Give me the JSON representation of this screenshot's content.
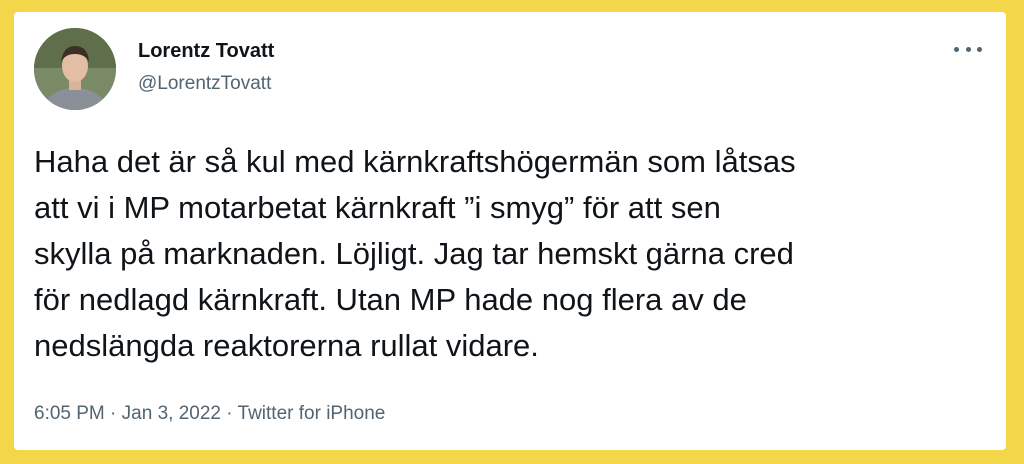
{
  "tweet": {
    "author_name": "Lorentz Tovatt",
    "author_handle": "@LorentzTovatt",
    "more_icon": "more-horizontal-icon",
    "text_lines": [
      "Haha det är så kul med kärnkraftshögermän som låtsas",
      "att vi i MP motarbetat kärnkraft ”i smyg” för att sen",
      "skylla på marknaden. Löjligt. Jag tar hemskt gärna cred",
      "för nedlagd kärnkraft. Utan MP hade nog flera av de",
      "nedslängda reaktorerna rullat vidare."
    ],
    "time": "6:05 PM",
    "separator": " · ",
    "date": "Jan 3, 2022",
    "source": "Twitter for iPhone"
  },
  "colors": {
    "frame": "#f4d64a",
    "text": "#0f1419",
    "muted": "#536471"
  }
}
